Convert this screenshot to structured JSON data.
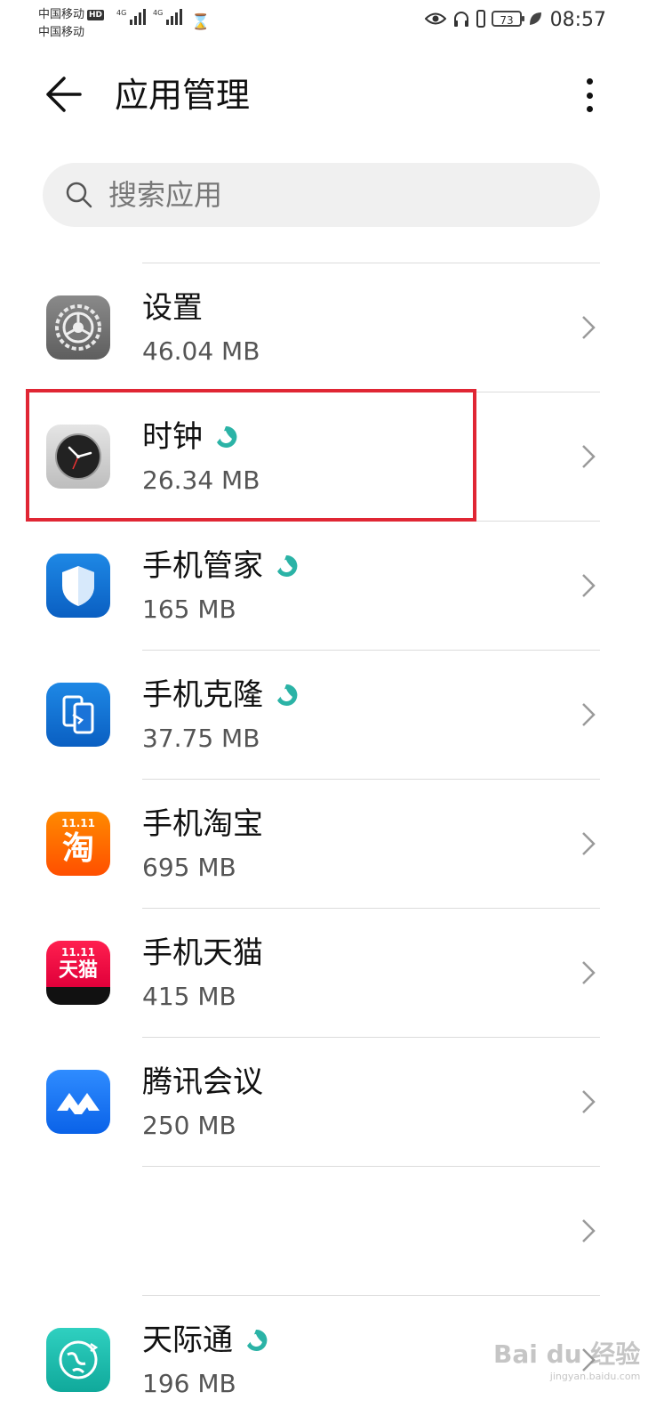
{
  "status_bar": {
    "carrier1": "中国移动",
    "hd_badge": "HD",
    "carrier2": "中国移动",
    "net1": "4G",
    "net2": "4G",
    "battery": "73",
    "time": "08:57",
    "icons": [
      "eye-icon",
      "headphones-icon",
      "leaf-icon",
      "hourglass-icon"
    ]
  },
  "header": {
    "title": "应用管理"
  },
  "search": {
    "placeholder": "搜索应用"
  },
  "apps": [
    {
      "name": "设置",
      "size": "46.04 MB",
      "badge": false,
      "icon": "settings-icon"
    },
    {
      "name": "时钟",
      "size": "26.34 MB",
      "badge": true,
      "icon": "clock-icon"
    },
    {
      "name": "手机管家",
      "size": "165 MB",
      "badge": true,
      "icon": "phone-manager-icon"
    },
    {
      "name": "手机克隆",
      "size": "37.75 MB",
      "badge": true,
      "icon": "phone-clone-icon"
    },
    {
      "name": "手机淘宝",
      "size": "695 MB",
      "badge": false,
      "icon": "taobao-icon",
      "icon_text": "淘",
      "icon_top": "11.11"
    },
    {
      "name": "手机天猫",
      "size": "415 MB",
      "badge": false,
      "icon": "tmall-icon",
      "icon_text": "天猫",
      "icon_top": "11.11"
    },
    {
      "name": "腾讯会议",
      "size": "250 MB",
      "badge": false,
      "icon": "tencent-meeting-icon"
    },
    {
      "name": "",
      "size": "",
      "badge": false,
      "icon": ""
    },
    {
      "name": "天际通",
      "size": "196 MB",
      "badge": true,
      "icon": "skytone-icon"
    }
  ],
  "watermark": {
    "text": "Bai du 经验",
    "sub": "jingyan.baidu.com"
  },
  "colors": {
    "highlight": "#e02634",
    "badge": "#2bb3a6",
    "chevron": "#9a9a9a"
  }
}
